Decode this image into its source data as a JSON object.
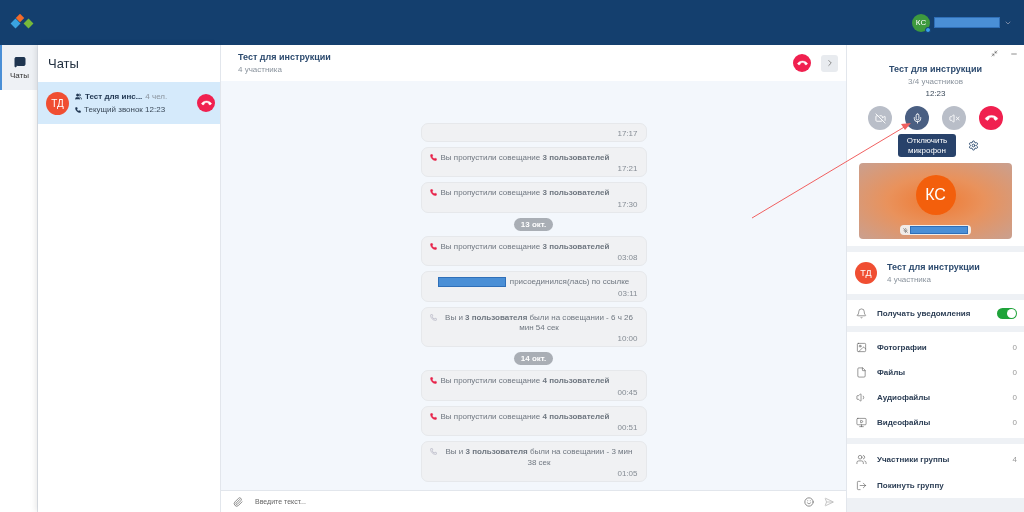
{
  "nav": {
    "items": [
      {
        "label": "Чаты",
        "selected": true
      }
    ]
  },
  "user": {
    "initials": "КС",
    "online": true
  },
  "chat_list": {
    "title": "Чаты",
    "items": [
      {
        "initials": "ТД",
        "name": "Тест для инс...",
        "members": "4 чел.",
        "status": "Текущий звонок 12:23",
        "selected": true,
        "in_call": true
      }
    ]
  },
  "chat": {
    "title": "Тест для инструкции",
    "subtitle": "4 участника",
    "messages": [
      {
        "kind": "time_only",
        "time": "17:17"
      },
      {
        "kind": "missed",
        "text": "Вы пропустили совещание **3 пользователей**",
        "time": "17:21"
      },
      {
        "kind": "missed",
        "text": "Вы пропустили совещание **3 пользователей**",
        "time": "17:30"
      },
      {
        "kind": "date",
        "text": "13 окт."
      },
      {
        "kind": "missed",
        "text": "Вы пропустили совещание **3 пользователей**",
        "time": "03:08"
      },
      {
        "kind": "joined",
        "text": "присоединился(лась) по ссылке",
        "time": "03:11"
      },
      {
        "kind": "attended",
        "text": "Вы и **3 пользователя** были на совещании - 6 ч 26 мин 54 сек",
        "time": "10:00"
      },
      {
        "kind": "date",
        "text": "14 окт."
      },
      {
        "kind": "missed",
        "text": "Вы пропустили совещание **4 пользователей**",
        "time": "00:45"
      },
      {
        "kind": "missed",
        "text": "Вы пропустили совещание **4 пользователей**",
        "time": "00:51"
      },
      {
        "kind": "attended",
        "text": "Вы и **3 пользователя** были на совещании - 3 мин 38 сек",
        "time": "01:05"
      }
    ],
    "composer": {
      "placeholder": "Введите текст..."
    }
  },
  "call": {
    "title": "Тест для инструкции",
    "participants": "3/4 участников",
    "duration": "12:23",
    "controls": [
      {
        "kind": "camera",
        "on": false
      },
      {
        "kind": "mic",
        "on": true
      },
      {
        "kind": "speaker",
        "on": false
      },
      {
        "kind": "hangup",
        "on": true
      }
    ],
    "tooltip": "Отключить микрофон",
    "tile": {
      "initials": "КС"
    }
  },
  "info": {
    "initials": "ТД",
    "title": "Тест для инструкции",
    "subtitle": "4 участника"
  },
  "notifications": {
    "label": "Получать уведомления",
    "on": true
  },
  "media": [
    {
      "kind": "photo",
      "label": "Фотографии",
      "count": "0"
    },
    {
      "kind": "file",
      "label": "Файлы",
      "count": "0"
    },
    {
      "kind": "audio",
      "label": "Аудиофайлы",
      "count": "0"
    },
    {
      "kind": "video",
      "label": "Видеофайлы",
      "count": "0"
    }
  ],
  "group": [
    {
      "kind": "members",
      "label": "Участники группы",
      "count": "4"
    },
    {
      "kind": "leave",
      "label": "Покинуть группу"
    }
  ]
}
